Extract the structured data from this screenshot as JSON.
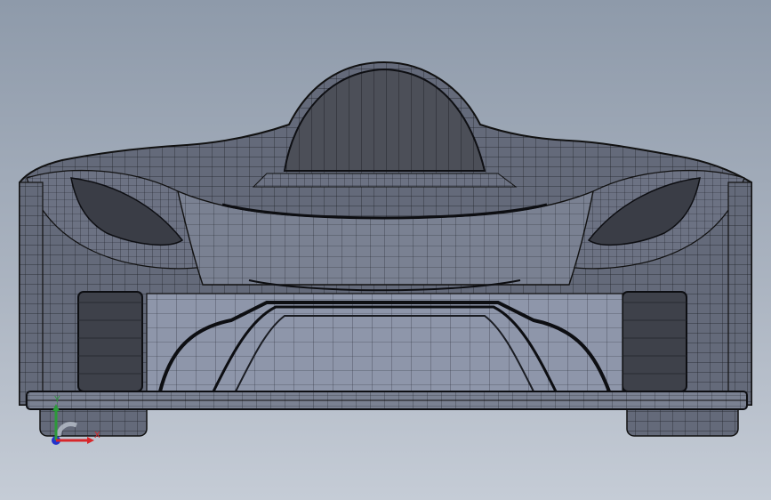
{
  "viewport": {
    "background_top": "#8e9aaa",
    "background_bottom": "#c5ccd6"
  },
  "model": {
    "render_style": "shaded-with-edges",
    "surface_color": "#6a7080",
    "edge_color": "#1a1c22",
    "dark_surface_color": "#4c4f58"
  },
  "triad": {
    "x_label": "X",
    "y_label": "Y",
    "x_color": "#d8262a",
    "y_color": "#2c9a3a",
    "z_color": "#2233cc"
  }
}
